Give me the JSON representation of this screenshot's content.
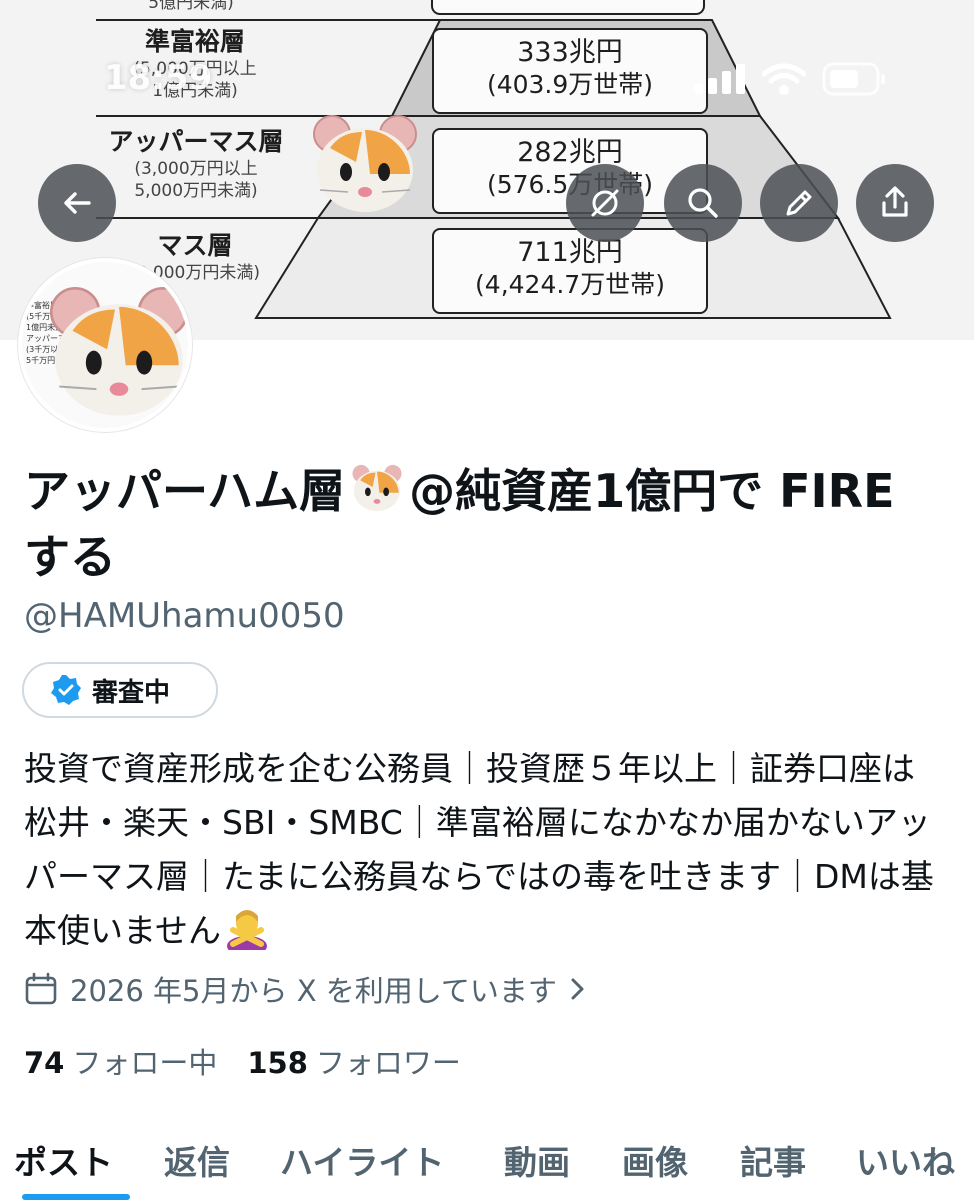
{
  "status_bar": {
    "time": "18:59"
  },
  "banner": {
    "top_cut_label": "5億円未満)",
    "tiers": [
      {
        "name": "準富裕層",
        "range_line1": "(5,000万円以上",
        "range_line2": "1億円未満)",
        "amount": "333兆円",
        "households": "(403.9万世帯)"
      },
      {
        "name": "アッパーマス層",
        "range_line1": "(3,000万円以上",
        "range_line2": "5,000万円未満)",
        "amount": "282兆円",
        "households": "(576.5万世帯)"
      },
      {
        "name": "マス層",
        "range_line1": "(3,000万円未満)",
        "range_line2": "",
        "amount": "711兆円",
        "households": "(4,424.7万世帯)"
      }
    ]
  },
  "nav": {
    "icons": [
      "back-arrow-icon",
      "grok-icon",
      "search-icon",
      "pencil-icon",
      "share-icon"
    ]
  },
  "avatar": {
    "mini_text": [
      "準富裕層",
      "(5千万以上",
      "1億円未満)",
      "アッパーマス層",
      "(3千万以上",
      "5千万円未満)"
    ]
  },
  "profile": {
    "display_name_part1": "アッパーハム層",
    "display_name_part2": "@純資産1億円で FIRE する",
    "handle": "@HAMUhamu0050",
    "verification_label": "審査中",
    "bio": "投資で資産形成を企む公務員｜投資歴５年以上｜証券口座は松井・楽天・SBI・SMBC｜準富裕層になかなか届かないアッパーマス層｜たまに公務員ならではの毒を吐きます｜DMは基本使いません",
    "joined": "2026 年5月から X を利用しています",
    "following_count": "74",
    "following_label": "フォロー中",
    "followers_count": "158",
    "followers_label": "フォロワー"
  },
  "tabs": [
    {
      "label": "ポスト",
      "active": true
    },
    {
      "label": "返信"
    },
    {
      "label": "ハイライト"
    },
    {
      "label": "動画"
    },
    {
      "label": "画像"
    },
    {
      "label": "記事"
    },
    {
      "label": "いいね"
    }
  ],
  "colors": {
    "accent": "#1d9bf0",
    "secondary_text": "#536471",
    "primary_text": "#0f1419"
  }
}
